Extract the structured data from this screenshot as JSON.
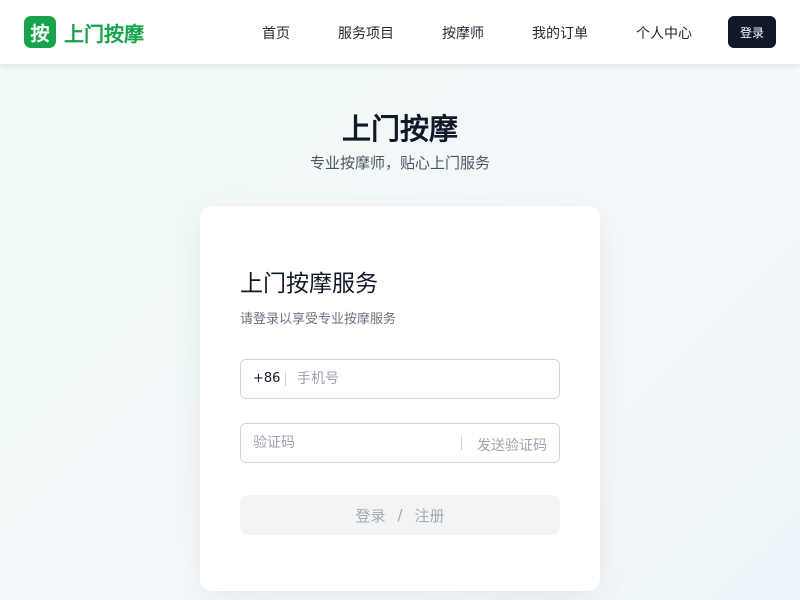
{
  "header": {
    "logo_badge": "按",
    "logo_text": "上门按摩",
    "nav": [
      {
        "label": "首页"
      },
      {
        "label": "服务项目"
      },
      {
        "label": "按摩师"
      },
      {
        "label": "我的订单"
      },
      {
        "label": "个人中心"
      }
    ],
    "login_label": "登录"
  },
  "hero": {
    "title": "上门按摩",
    "subtitle": "专业按摩师，贴心上门服务"
  },
  "card": {
    "title": "上门按摩服务",
    "subtitle": "请登录以享受专业按摩服务",
    "phone": {
      "prefix": "+86",
      "placeholder": "手机号",
      "value": ""
    },
    "code": {
      "placeholder": "验证码",
      "value": "",
      "send_label": "发送验证码"
    },
    "submit": {
      "login": "登录",
      "separator": "/",
      "register": "注册"
    }
  },
  "colors": {
    "brand": "#16a34a",
    "dark_button": "#111827",
    "disabled_button_bg": "#f3f4f6",
    "disabled_text": "#a3a8b0"
  }
}
